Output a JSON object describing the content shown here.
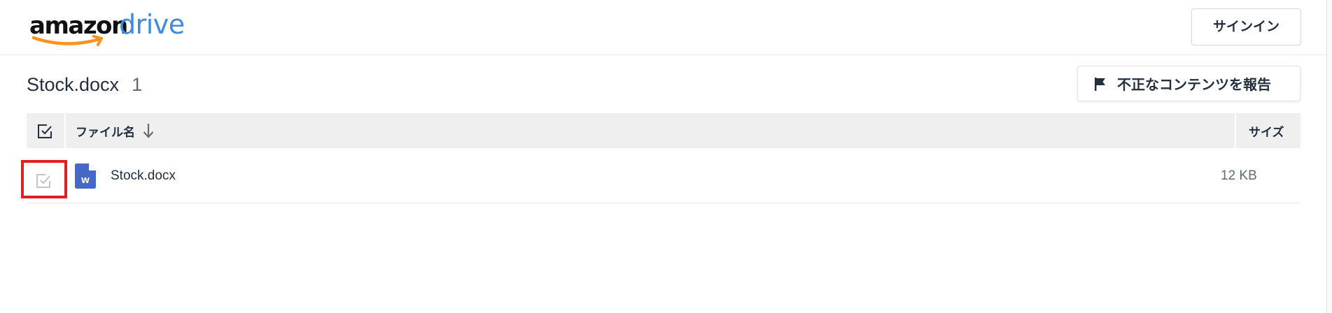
{
  "header": {
    "logo_amazon": "amazon",
    "logo_drive": "drive",
    "signin_label": "サインイン"
  },
  "file": {
    "title": "Stock.docx",
    "count": "1"
  },
  "report_button": {
    "label": "不正なコンテンツを報告",
    "icon": "flag-icon"
  },
  "table": {
    "columns": {
      "name": "ファイル名",
      "size": "サイズ"
    },
    "rows": [
      {
        "name": "Stock.docx",
        "size": "12 KB",
        "icon": "word-document-icon",
        "icon_letter": "W"
      }
    ]
  },
  "colors": {
    "brand_blue": "#3d8bdd",
    "amazon_orange": "#f7941d",
    "word_blue": "#4668c8",
    "highlight_red": "#e11e26",
    "header_gray": "#efefef",
    "text_dark": "#232f3e",
    "text_muted": "#5f6b7a"
  }
}
